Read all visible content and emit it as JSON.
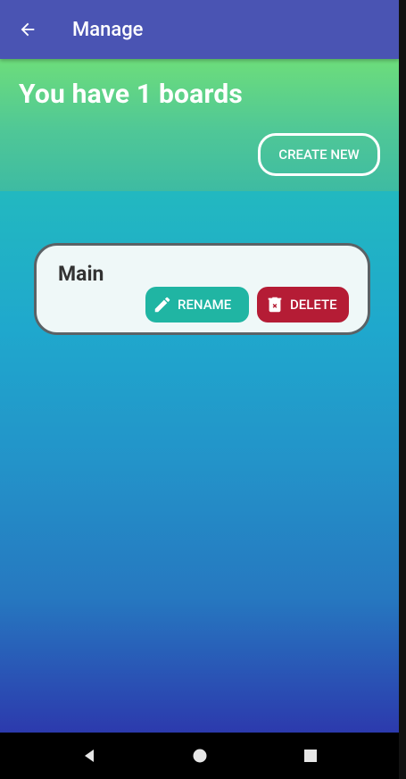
{
  "appbar": {
    "title": "Manage",
    "back_icon": "arrow-left-icon"
  },
  "header": {
    "count_text": "You have 1 boards",
    "create_label": "CREATE NEW"
  },
  "boards": [
    {
      "name": "Main",
      "rename_label": "RENAME",
      "delete_label": "DELETE"
    }
  ],
  "colors": {
    "appbar": "#4a54b3",
    "header_top": "#6ddd7b",
    "header_bottom": "#3ebba2",
    "rename": "#20b5a3",
    "delete": "#b51c35"
  },
  "navbar": {
    "icons": [
      "nav-back-icon",
      "nav-home-icon",
      "nav-recents-icon"
    ]
  }
}
